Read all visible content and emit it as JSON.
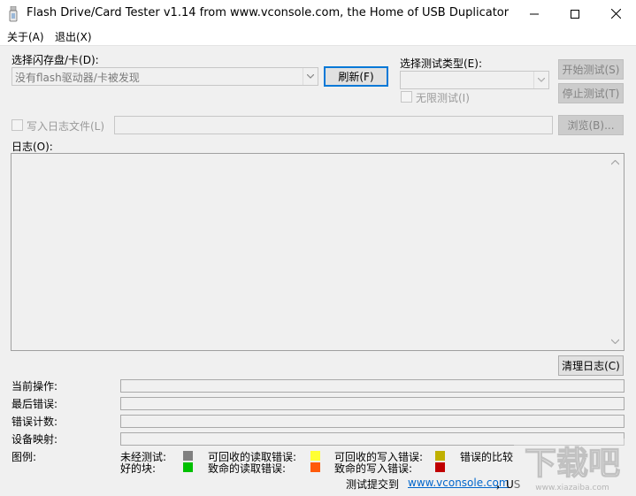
{
  "window": {
    "title": "Flash Drive/Card Tester v1.14 from www.vconsole.com, the Home of USB Duplicator",
    "minimize_icon": "minimize-icon",
    "maximize_icon": "maximize-icon",
    "close_icon": "close-icon"
  },
  "menu": {
    "about": "关于(A)",
    "exit": "退出(X)"
  },
  "drive": {
    "label": "选择闪存盘/卡(D):",
    "value": "没有flash驱动器/卡被发现",
    "refresh_label": "刷新(F)"
  },
  "test_type": {
    "label": "选择测试类型(E):",
    "value": "",
    "infinite_label": "无限测试(I)",
    "infinite_checked": false
  },
  "actions": {
    "start_label": "开始测试(S)",
    "stop_label": "停止测试(T)"
  },
  "log_file": {
    "label": "写入日志文件(L)",
    "checked": false,
    "path": "",
    "browse_label": "浏览(B)..."
  },
  "log": {
    "label": "日志(O):",
    "content": "",
    "clear_label": "清理日志(C)"
  },
  "status": {
    "current_op_label": "当前操作:",
    "last_error_label": "最后错误:",
    "error_count_label": "错误计数:",
    "device_map_label": "设备映射:"
  },
  "legend": {
    "label": "图例:",
    "items": [
      {
        "label": "未经测试:",
        "color": "#808080"
      },
      {
        "label": "可回收的读取错误:",
        "color": "#ffff33"
      },
      {
        "label": "可回收的写入错误:",
        "color": "#c0b000"
      },
      {
        "label": "错误的比较",
        "color": ""
      },
      {
        "label": "好的块:",
        "color": "#00c000"
      },
      {
        "label": "致命的读取错误:",
        "color": "#ff5a0a"
      },
      {
        "label": "致命的写入错误:",
        "color": "#c00000"
      }
    ]
  },
  "footer": {
    "submit_text": "测试提交到",
    "link_text": "www.vconsole.com",
    "suffix_text": "，US"
  },
  "watermark": {
    "text": "下载吧",
    "sub": "www.xiazaiba.com"
  }
}
